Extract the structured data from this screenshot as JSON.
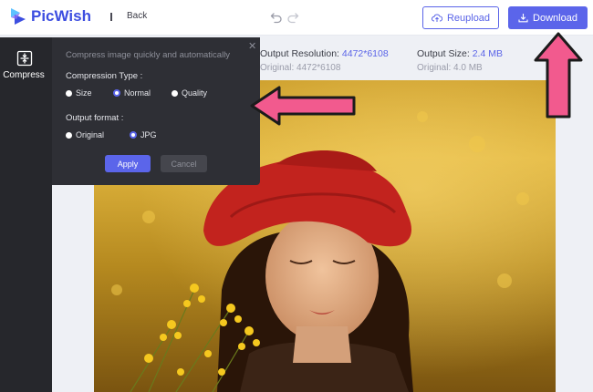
{
  "header": {
    "brand": "PicWish",
    "back_label": "Back",
    "reupload_label": "Reupload",
    "download_label": "Download"
  },
  "sidebar": {
    "tools": [
      {
        "label": "Compress",
        "icon": "compress-icon"
      }
    ]
  },
  "compress_panel": {
    "subtitle": "Compress image quickly and automatically",
    "compression_type_label": "Compression Type :",
    "compression_options": [
      "Size",
      "Normal",
      "Quality"
    ],
    "compression_selected": "Normal",
    "output_format_label": "Output format :",
    "format_options": [
      "Original",
      "JPG"
    ],
    "format_selected": "JPG",
    "apply_label": "Apply",
    "cancel_label": "Cancel"
  },
  "info": {
    "resolution_label": "Output Resolution:",
    "resolution_value": "4472*6108",
    "original_resolution": "Original: 4472*6108",
    "size_label": "Output Size:",
    "size_value": "2.4 MB",
    "original_size": "Original: 4.0 MB"
  },
  "colors": {
    "accent": "#5b65ea",
    "panel_bg": "#2e2f35",
    "sidebar_bg": "#26272c",
    "annotation_arrow": "#f25a8e"
  }
}
